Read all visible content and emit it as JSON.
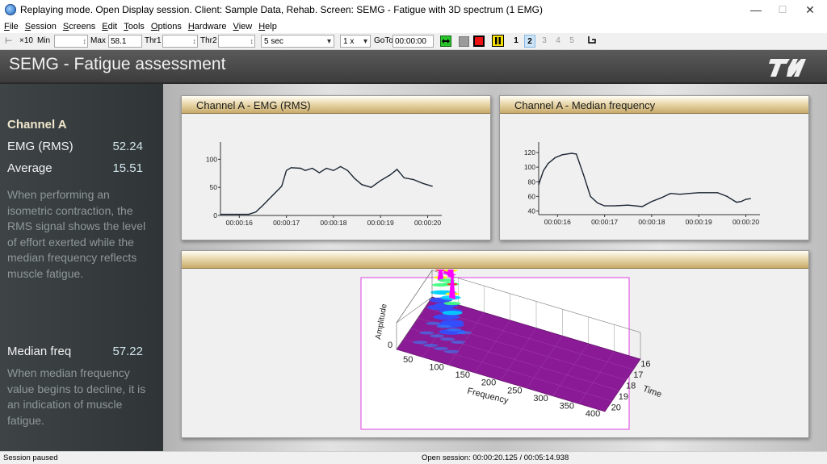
{
  "window": {
    "title": "Replaying mode. Open Display session. Client: Sample Data, Rehab. Screen: SEMG - Fatigue with 3D spectrum (1 EMG)",
    "minimize_glyph": "—",
    "maximize_glyph": "☐",
    "close_glyph": "✕"
  },
  "menu": [
    "File",
    "Session",
    "Screens",
    "Edit",
    "Tools",
    "Options",
    "Hardware",
    "View",
    "Help"
  ],
  "toolbar": {
    "x10_label": "×10",
    "min_label": "Min",
    "min_value": "",
    "max_label": "Max",
    "max_value": "58.1",
    "thr1_label": "Thr1",
    "thr1_value": "",
    "thr2_label": "Thr2",
    "thr2_value": "",
    "timebase": "5 sec",
    "speed": "1 x",
    "goto_label": "GoTo",
    "goto_value": "00:00:00",
    "pages": [
      "1",
      "2",
      "3",
      "4",
      "5"
    ],
    "selected_page": "2"
  },
  "header": {
    "title": "SEMG - Fatigue assessment"
  },
  "left_panel": {
    "channel_heading": "Channel A",
    "emg_label": "EMG (RMS)",
    "emg_value": "52.24",
    "avg_label": "Average",
    "avg_value": "15.51",
    "description1": "When performing an isometric contraction, the RMS signal shows the level of effort exerted while the median frequency reflects muscle fatigue.",
    "median_label": "Median freq",
    "median_value": "57.22",
    "description2": "When median frequency value begins to decline, it is an indication of muscle fatigue."
  },
  "cards": {
    "rms_title": "Channel A - EMG (RMS)",
    "median_title": "Channel A - Median frequency",
    "spectrum_title": ""
  },
  "chart_data": [
    {
      "type": "line",
      "title": "Channel A - EMG (RMS)",
      "xlabel": "",
      "ylabel": "",
      "ylim": [
        0,
        125
      ],
      "yticks": [
        0,
        50,
        100
      ],
      "xticks": [
        "00:00:16",
        "00:00:17",
        "00:00:18",
        "00:00:19",
        "00:00:20"
      ],
      "xlim": [
        15.6,
        20.3
      ],
      "x": [
        15.6,
        16.0,
        16.2,
        16.35,
        16.5,
        16.7,
        16.9,
        17.0,
        17.1,
        17.3,
        17.4,
        17.55,
        17.7,
        17.85,
        18.0,
        18.15,
        18.3,
        18.45,
        18.6,
        18.8,
        19.0,
        19.2,
        19.35,
        19.5,
        19.7,
        19.9,
        20.1
      ],
      "y": [
        2,
        2,
        2,
        6,
        18,
        35,
        52,
        80,
        85,
        84,
        80,
        84,
        76,
        84,
        80,
        87,
        80,
        66,
        55,
        50,
        62,
        72,
        82,
        67,
        64,
        57,
        52
      ],
      "grid": false,
      "line_color": "#1a2533"
    },
    {
      "type": "line",
      "title": "Channel A - Median frequency",
      "xlabel": "",
      "ylabel": "",
      "ylim": [
        35,
        130
      ],
      "yticks": [
        40,
        60,
        80,
        100,
        120
      ],
      "xticks": [
        "00:00:16",
        "00:00:17",
        "00:00:18",
        "00:00:19",
        "00:00:20"
      ],
      "xlim": [
        15.6,
        20.3
      ],
      "x": [
        15.6,
        15.7,
        15.8,
        15.95,
        16.1,
        16.3,
        16.4,
        16.55,
        16.7,
        16.85,
        17.0,
        17.2,
        17.5,
        17.8,
        18.0,
        18.2,
        18.4,
        18.6,
        18.8,
        19.0,
        19.2,
        19.4,
        19.6,
        19.8,
        19.9,
        20.0,
        20.1
      ],
      "y": [
        76,
        95,
        105,
        113,
        117,
        119,
        118,
        90,
        60,
        51,
        47,
        47,
        48,
        46,
        53,
        58,
        64,
        63,
        64,
        65,
        65,
        65,
        60,
        52,
        53,
        56,
        57
      ],
      "grid": false,
      "line_color": "#1a2533"
    },
    {
      "type": "surface-3d",
      "title": "",
      "xlabel": "Frequency",
      "ylabel": "Time",
      "zlabel": "Amplitude",
      "x_ticks": [
        50,
        100,
        150,
        200,
        250,
        300,
        350,
        400
      ],
      "y_ticks": [
        16,
        17,
        18,
        19,
        20
      ],
      "z_ticks": [
        0
      ],
      "peaks": [
        {
          "frequency": 50,
          "time": 16.2,
          "amplitude": 0.55
        },
        {
          "frequency": 70,
          "time": 16.8,
          "amplitude": 0.9
        },
        {
          "frequency": 85,
          "time": 17.3,
          "amplitude": 1.0
        },
        {
          "frequency": 95,
          "time": 17.8,
          "amplitude": 0.7
        }
      ],
      "colormap": [
        "#7a2a8a",
        "#3050ff",
        "#00d0ff",
        "#40ff80",
        "#ffee00",
        "#ff2a1a",
        "#ff00ff"
      ],
      "floor_color": "#8a1a95",
      "frame_color": "#e040e0"
    }
  ],
  "status": {
    "left": "Session paused",
    "center": "Open session: 00:00:20.125 / 00:05:14.938"
  }
}
